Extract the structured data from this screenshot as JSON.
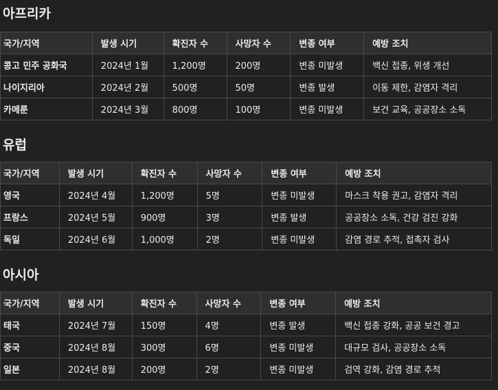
{
  "sections": [
    {
      "title": "아프리카",
      "headers": [
        "국가/지역",
        "발생 시기",
        "확진자 수",
        "사망자 수",
        "변종 여부",
        "예방 조치"
      ],
      "rows": [
        [
          "콩고 민주 공화국",
          "2024년 1월",
          "1,200명",
          "200명",
          "변종 미발생",
          "백신 접종, 위생 개선"
        ],
        [
          "나이지리아",
          "2024년 2월",
          "500명",
          "50명",
          "변종 발생",
          "이동 제한, 감염자 격리"
        ],
        [
          "카메룬",
          "2024년 3월",
          "800명",
          "100명",
          "변종 미발생",
          "보건 교육, 공공장소 소독"
        ]
      ]
    },
    {
      "title": "유럽",
      "headers": [
        "국가/지역",
        "발생 시기",
        "확진자 수",
        "사망자 수",
        "변종 여부",
        "예방 조치"
      ],
      "rows": [
        [
          "영국",
          "2024년 4월",
          "1,200명",
          "5명",
          "변종 미발생",
          "마스크 착용 권고, 감염자 격리"
        ],
        [
          "프랑스",
          "2024년 5월",
          "900명",
          "3명",
          "변종 발생",
          "공공장소 소독, 건강 검진 강화"
        ],
        [
          "독일",
          "2024년 6월",
          "1,000명",
          "2명",
          "변종 미발생",
          "감염 경로 추적, 접촉자 검사"
        ]
      ]
    },
    {
      "title": "아시아",
      "headers": [
        "국가/지역",
        "발생 시기",
        "확진자 수",
        "사망자 수",
        "변종 여부",
        "예방 조치"
      ],
      "rows": [
        [
          "태국",
          "2024년 7월",
          "150명",
          "4명",
          "변종 발생",
          "백신 접종 강화, 공공 보건 경고"
        ],
        [
          "중국",
          "2024년 8월",
          "300명",
          "6명",
          "변종 미발생",
          "대규모 검사, 공공장소 소독"
        ],
        [
          "일본",
          "2024년 8월",
          "200명",
          "2명",
          "변종 미발생",
          "검역 강화, 감염 경로 추적"
        ]
      ]
    }
  ]
}
